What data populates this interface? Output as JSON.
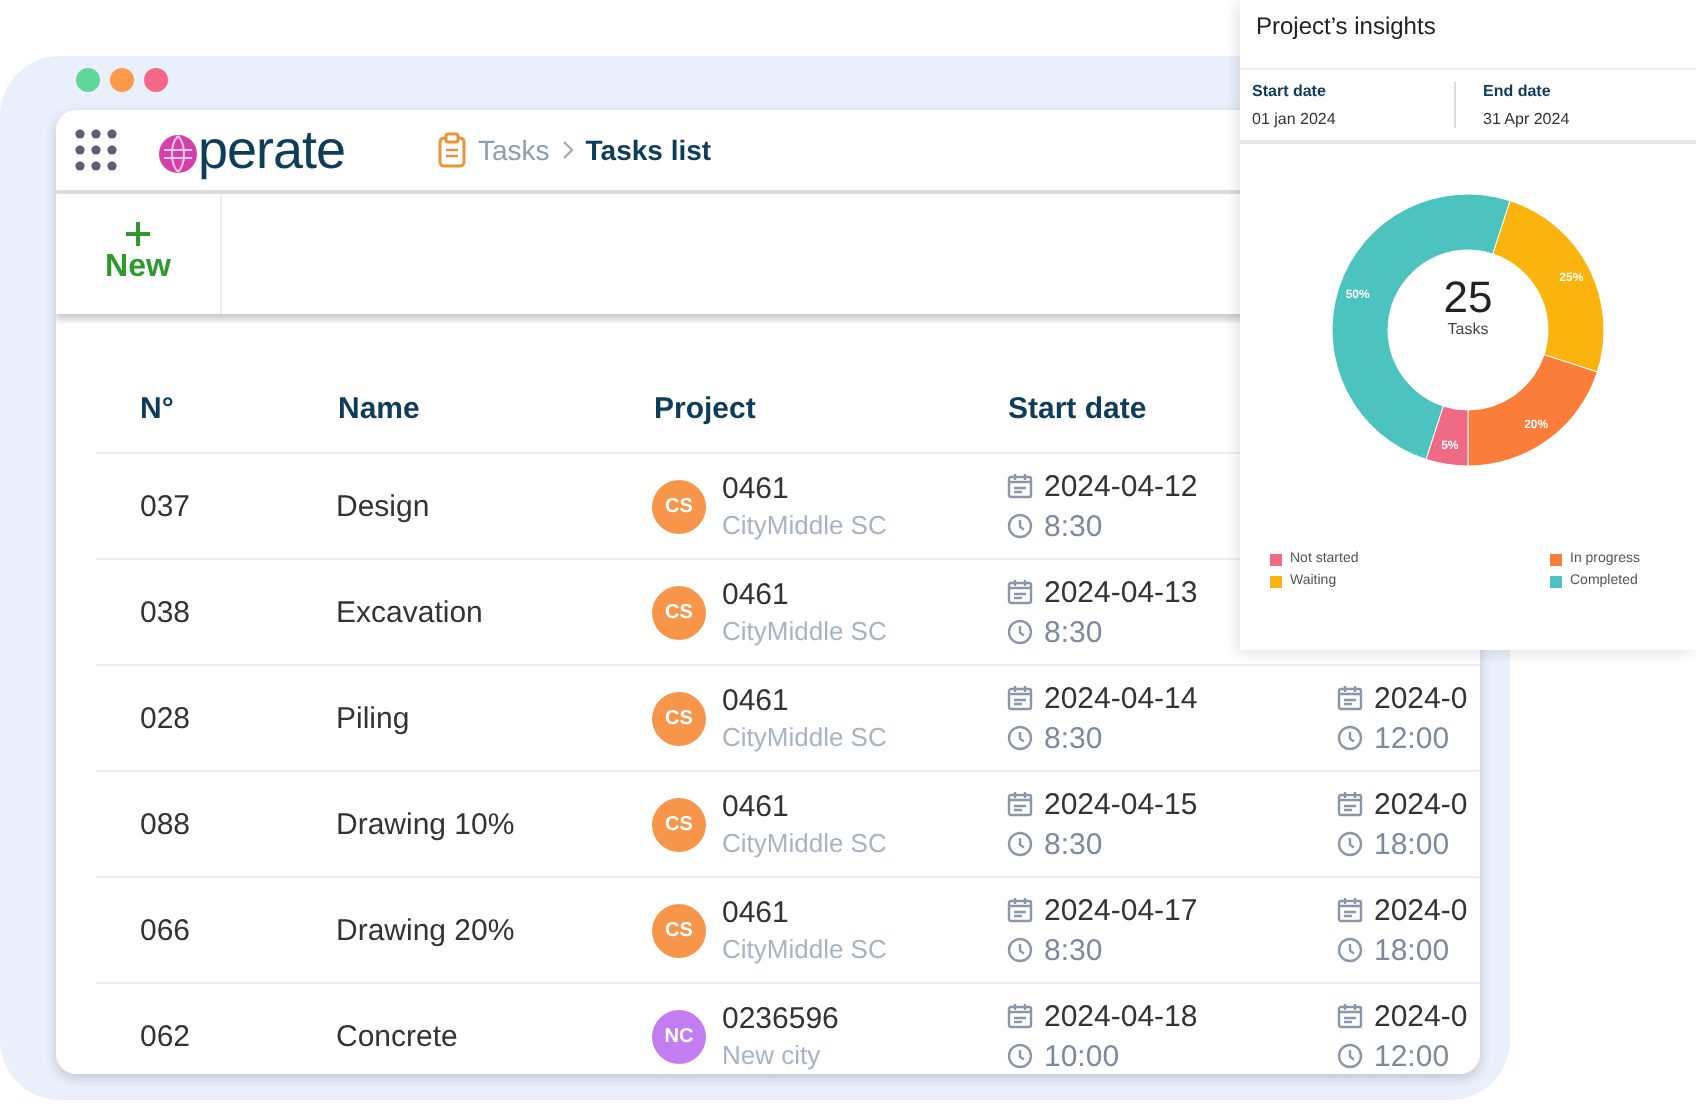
{
  "header": {
    "logo_text": "perate",
    "breadcrumb": [
      "Tasks",
      "Tasks list"
    ]
  },
  "toolbar": {
    "new_label": "New"
  },
  "table": {
    "columns": [
      "N°",
      "Name",
      "Project",
      "Start date"
    ],
    "rows": [
      {
        "number": "037",
        "name": "Design",
        "avatar": "CS",
        "color": "#f7954a",
        "project": "0461",
        "city": "CityMiddle SC",
        "start_date": "2024-04-12",
        "start_time": "8:30"
      },
      {
        "number": "038",
        "name": "Excavation",
        "avatar": "CS",
        "color": "#f7954a",
        "project": "0461",
        "city": "CityMiddle SC",
        "start_date": "2024-04-13",
        "start_time": "8:30"
      },
      {
        "number": "028",
        "name": "Piling",
        "avatar": "CS",
        "color": "#f7954a",
        "project": "0461",
        "city": "CityMiddle SC",
        "start_date": "2024-04-14",
        "start_time": "8:30",
        "end_date": "2024-0",
        "end_time": "12:00"
      },
      {
        "number": "088",
        "name": "Drawing 10%",
        "avatar": "CS",
        "color": "#f7954a",
        "project": "0461",
        "city": "CityMiddle SC",
        "start_date": "2024-04-15",
        "start_time": "8:30",
        "end_date": "2024-0",
        "end_time": "18:00"
      },
      {
        "number": "066",
        "name": "Drawing 20%",
        "avatar": "CS",
        "color": "#f7954a",
        "project": "0461",
        "city": "CityMiddle SC",
        "start_date": "2024-04-17",
        "start_time": "8:30",
        "end_date": "2024-0",
        "end_time": "18:00"
      },
      {
        "number": "062",
        "name": "Concrete",
        "avatar": "NC",
        "color": "#c27ef0",
        "project": "0236596",
        "city": "New city",
        "start_date": "2024-04-18",
        "start_time": "10:00",
        "end_date": "2024-0",
        "end_time": "12:00"
      }
    ]
  },
  "insights": {
    "title": "Project’s insights",
    "start_label": "Start date",
    "start_value": "01 jan 2024",
    "end_label": "End date",
    "end_value": "31 Apr 2024",
    "center_value": "25",
    "center_label": "Tasks",
    "chart_data": {
      "type": "donut",
      "categories": [
        "Waiting",
        "In progress",
        "Not started",
        "Completed"
      ],
      "values": [
        25,
        20,
        5,
        50
      ],
      "colors": [
        "#fbb40e",
        "#fb7d3a",
        "#f06a86",
        "#4cc3bf"
      ],
      "value_labels": [
        "25%",
        "20%",
        "5%",
        "50%"
      ]
    }
  }
}
